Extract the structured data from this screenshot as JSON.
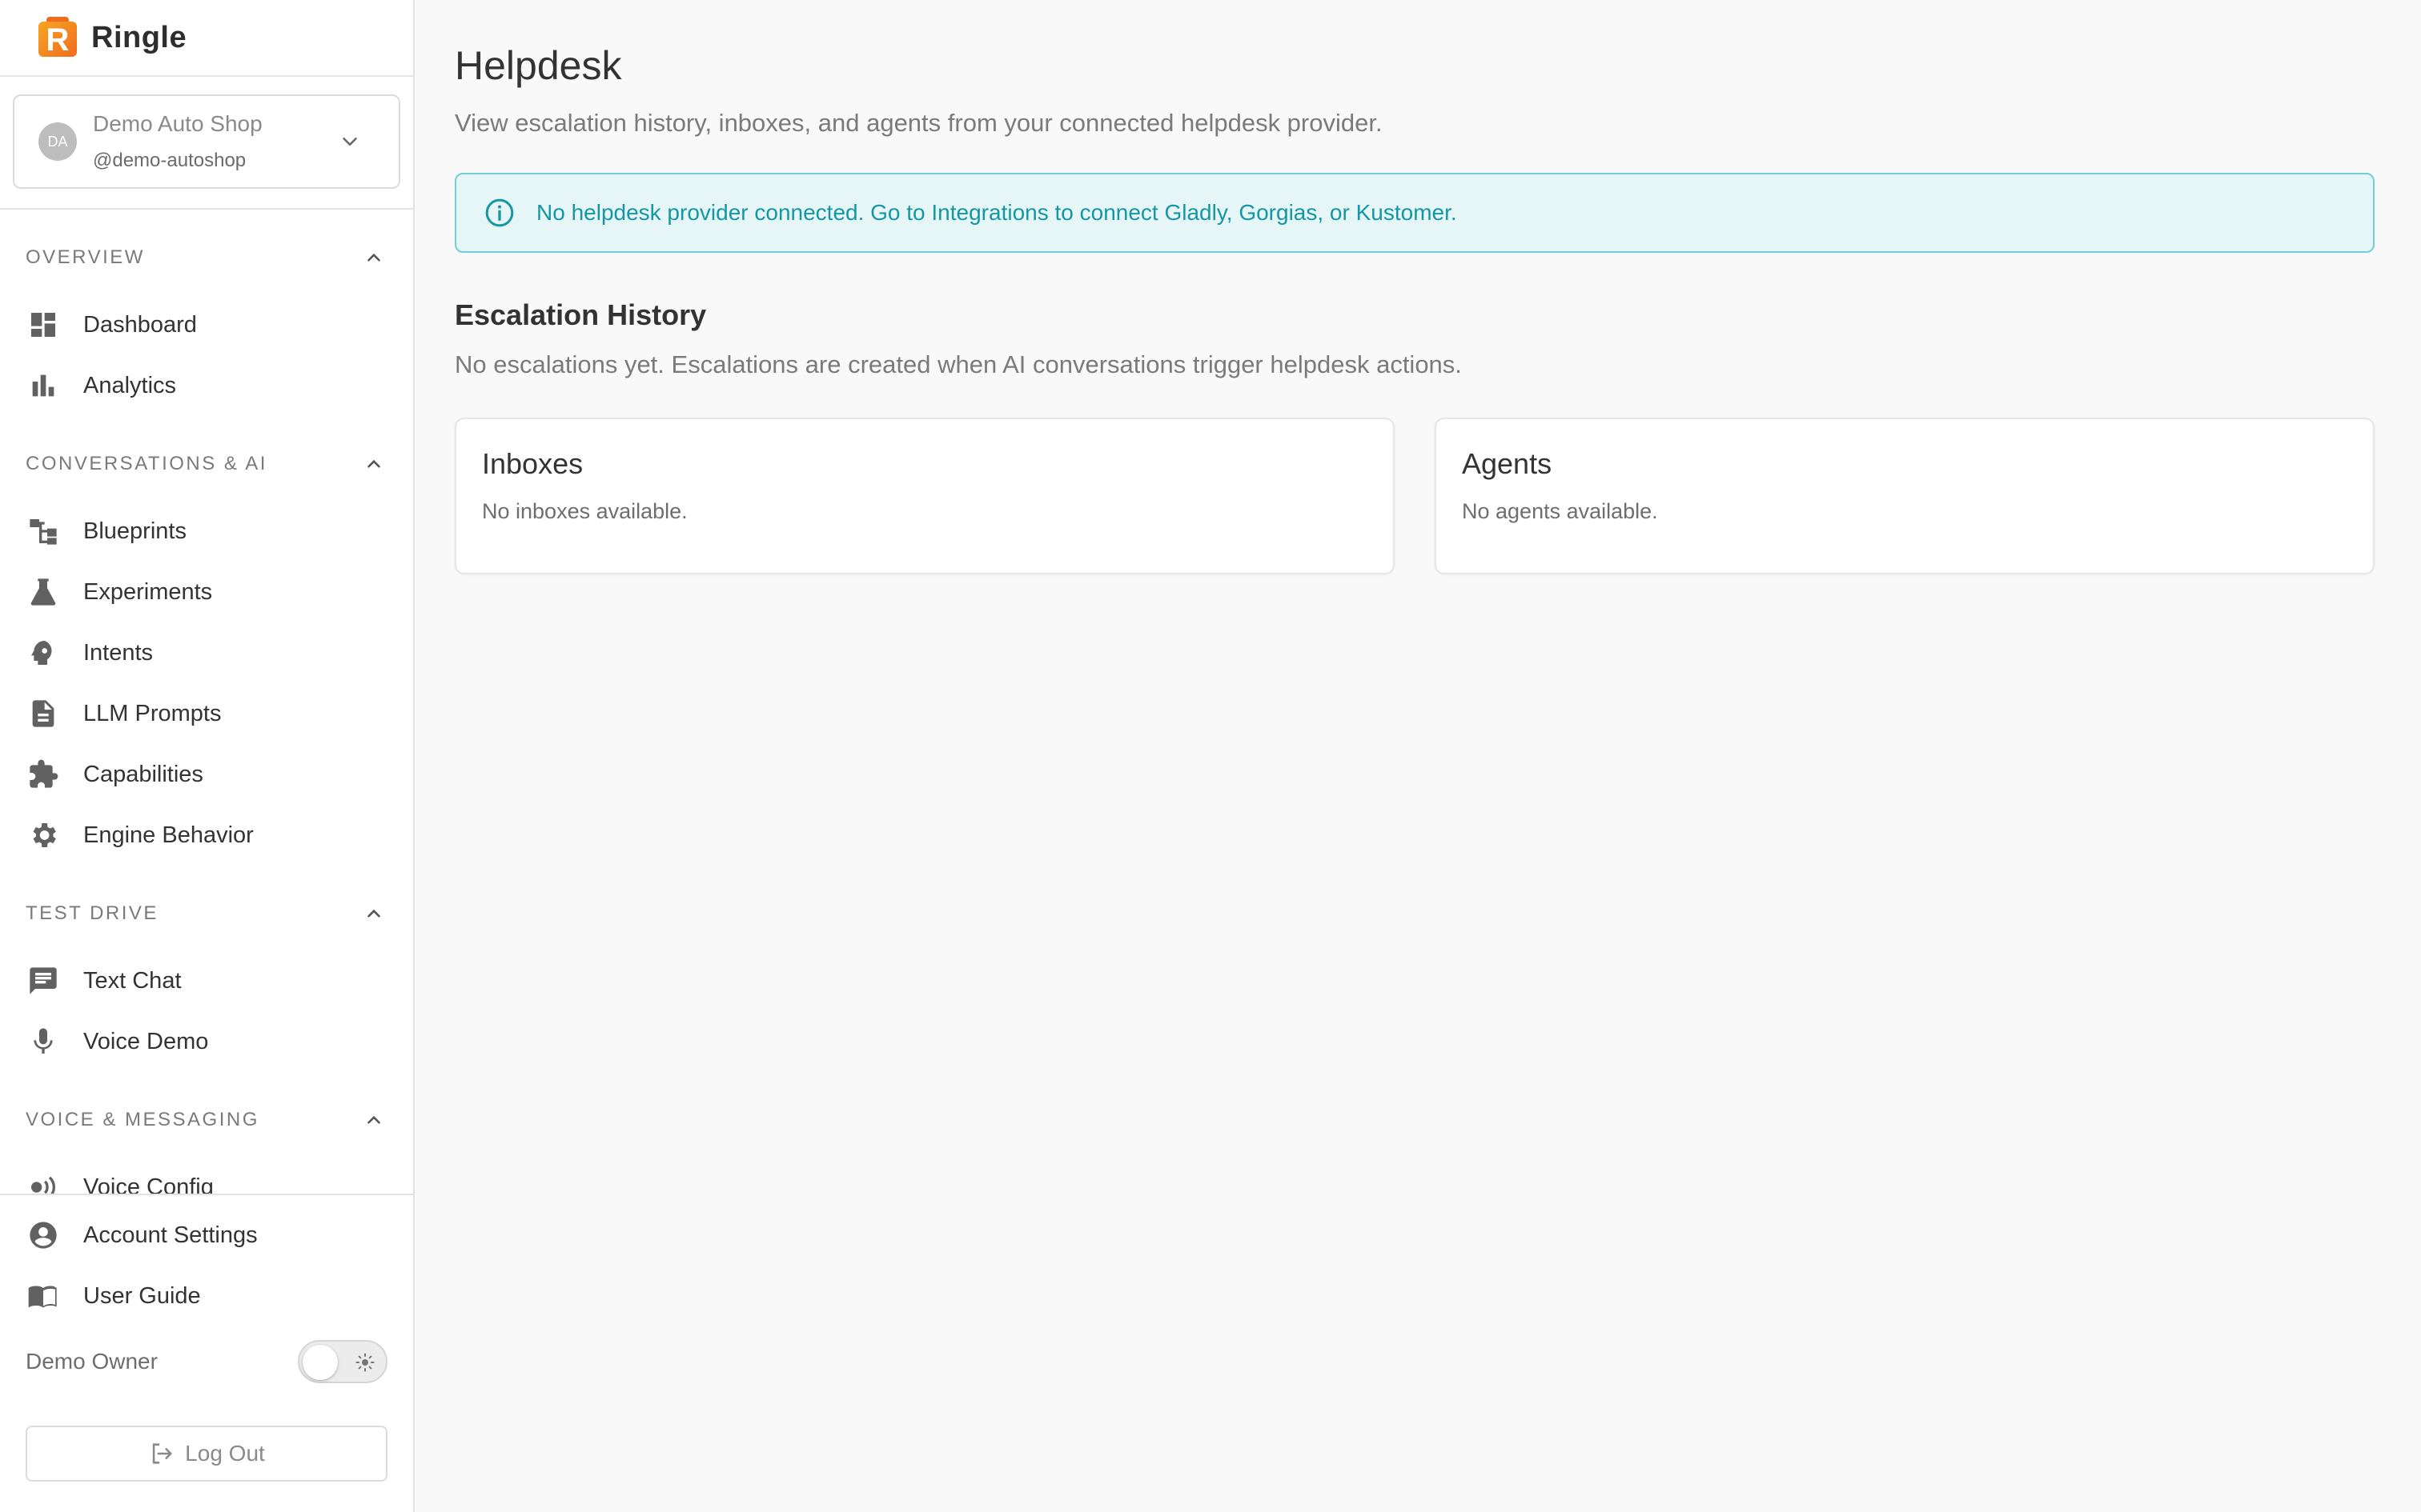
{
  "brand": {
    "name": "Ringle",
    "logo_letter": "R"
  },
  "org": {
    "initials": "DA",
    "name": "Demo Auto Shop",
    "handle": "@demo-autoshop"
  },
  "sidebar": {
    "sections": [
      {
        "title": "OVERVIEW",
        "items": [
          {
            "label": "Dashboard",
            "icon": "dashboard-icon"
          },
          {
            "label": "Analytics",
            "icon": "bar-chart-icon"
          }
        ]
      },
      {
        "title": "CONVERSATIONS & AI",
        "items": [
          {
            "label": "Blueprints",
            "icon": "flow-tree-icon"
          },
          {
            "label": "Experiments",
            "icon": "flask-icon"
          },
          {
            "label": "Intents",
            "icon": "head-gear-icon"
          },
          {
            "label": "LLM Prompts",
            "icon": "document-icon"
          },
          {
            "label": "Capabilities",
            "icon": "puzzle-icon"
          },
          {
            "label": "Engine Behavior",
            "icon": "gear-icon"
          }
        ]
      },
      {
        "title": "TEST DRIVE",
        "items": [
          {
            "label": "Text Chat",
            "icon": "chat-icon"
          },
          {
            "label": "Voice Demo",
            "icon": "microphone-icon"
          }
        ]
      },
      {
        "title": "VOICE & MESSAGING",
        "items": [
          {
            "label": "Voice Config",
            "icon": "voice-waves-icon"
          }
        ]
      }
    ],
    "bottom": {
      "account_settings": "Account Settings",
      "user_guide": "User Guide",
      "owner": "Demo Owner",
      "logout": "Log Out"
    }
  },
  "main": {
    "title": "Helpdesk",
    "subtitle": "View escalation history, inboxes, and agents from your connected helpdesk provider.",
    "alert": "No helpdesk provider connected. Go to Integrations to connect Gladly, Gorgias, or Kustomer.",
    "escalation": {
      "title": "Escalation History",
      "desc": "No escalations yet. Escalations are created when AI conversations trigger helpdesk actions."
    },
    "cards": {
      "inboxes": {
        "title": "Inboxes",
        "body": "No inboxes available."
      },
      "agents": {
        "title": "Agents",
        "body": "No agents available."
      }
    }
  },
  "colors": {
    "accent": "#f26b1d",
    "info_text": "#1497a3",
    "info_bg": "#e6f6f7",
    "info_border": "#6fd0d6"
  }
}
